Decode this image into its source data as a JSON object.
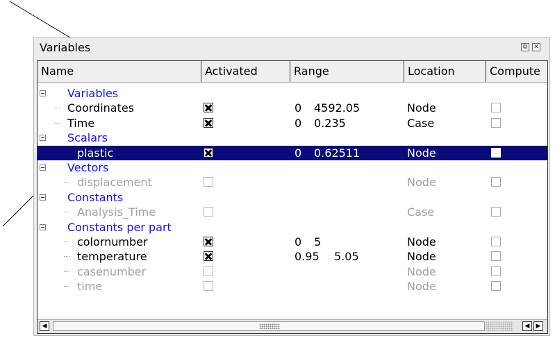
{
  "panel": {
    "title": "Variables",
    "float_icon": "float-window-icon",
    "close_icon": "close-window-icon"
  },
  "columns": [
    "Name",
    "Activated",
    "Range",
    "Location",
    "Compute"
  ],
  "rows": [
    {
      "name": "Variables",
      "kind": "group"
    },
    {
      "name": "Coordinates",
      "activated": true,
      "range_min": "0",
      "range_max": "4592.05",
      "location": "Node"
    },
    {
      "name": "Time",
      "activated": true,
      "range_min": "0",
      "range_max": "0.235",
      "location": "Case"
    },
    {
      "name": "Scalars",
      "kind": "group"
    },
    {
      "name": "plastic",
      "activated": true,
      "range_min": "0",
      "range_max": "0.62511",
      "location": "Node",
      "selected": true
    },
    {
      "name": "Vectors",
      "kind": "group"
    },
    {
      "name": "displacement",
      "activated": false,
      "range_min": "",
      "range_max": "",
      "location": "Node",
      "dim": true
    },
    {
      "name": "Constants",
      "kind": "group"
    },
    {
      "name": "Analysis_Time",
      "activated": false,
      "range_min": "",
      "range_max": "",
      "location": "Case",
      "dim": true
    },
    {
      "name": "Constants per part",
      "kind": "group"
    },
    {
      "name": "colornumber",
      "activated": true,
      "range_min": "0",
      "range_max": "5",
      "location": "Node"
    },
    {
      "name": "temperature",
      "activated": true,
      "range_min": "0.95",
      "range_max": "5.05",
      "location": "Node"
    },
    {
      "name": "casenumber",
      "activated": false,
      "range_min": "",
      "range_max": "",
      "location": "Node",
      "dim": true
    },
    {
      "name": "time",
      "activated": false,
      "range_min": "",
      "range_max": "",
      "location": "Node",
      "dim": true
    }
  ],
  "colors": {
    "group_text": "#1010ff",
    "selection": "#0a0a7a",
    "disabled_text": "#a0a0a0"
  }
}
